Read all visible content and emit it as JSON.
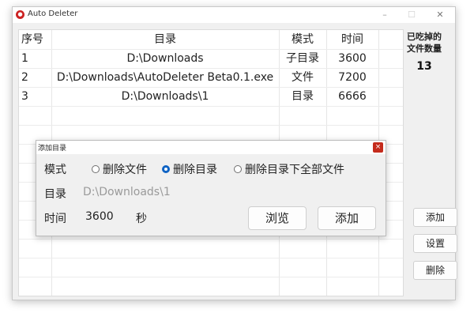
{
  "window": {
    "title": "Auto Deleter",
    "icon": "app-icon",
    "controls": {
      "minimize": "–",
      "maximize": "☐",
      "close": "✕"
    }
  },
  "table": {
    "headers": [
      "序号",
      "目录",
      "模式",
      "时间"
    ],
    "rows": [
      [
        "1",
        "D:\\Downloads",
        "子目录",
        "3600"
      ],
      [
        "2",
        "D:\\Downloads\\AutoDeleter Beta0.1.exe",
        "文件",
        "7200"
      ],
      [
        "3",
        "D:\\Downloads\\1",
        "目录",
        "6666"
      ]
    ]
  },
  "sidebar": {
    "counter_label": "已吃掉的文件数量",
    "counter_value": "13",
    "buttons": {
      "add": "添加",
      "settings": "设置",
      "delete": "删除"
    }
  },
  "dialog": {
    "title": "添加目录",
    "close": "×",
    "mode_label": "模式",
    "mode_options": [
      "删除文件",
      "删除目录",
      "删除目录下全部文件"
    ],
    "mode_selected": "删除目录",
    "dir_label": "目录",
    "dir_value": "D:\\Downloads\\1",
    "time_label": "时间",
    "time_value": "3600",
    "time_unit": "秒",
    "browse_button": "浏览",
    "add_button": "添加"
  },
  "colors": {
    "accent": "#0f63c4",
    "close_red": "#c42b1c",
    "app_icon": "#cc2222"
  }
}
